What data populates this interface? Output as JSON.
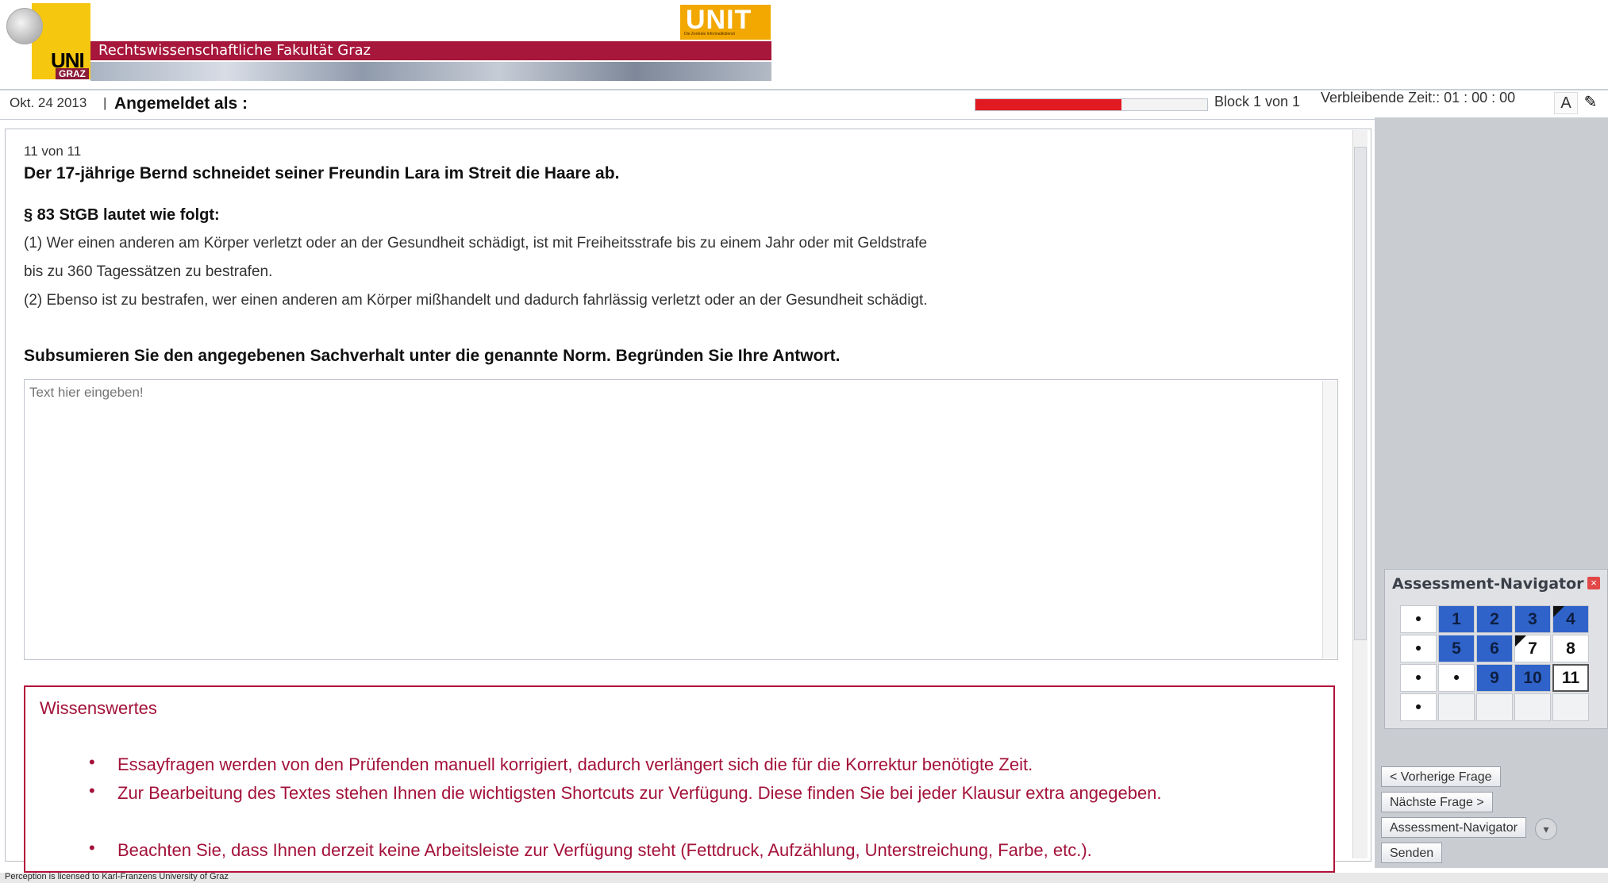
{
  "header": {
    "uni_logo": "UNI",
    "uni_sub": "GRAZ",
    "faculty": "Rechtswissenschaftliche Fakultät Graz",
    "unit_logo": "UNIT",
    "unit_sub": "Die Zentrale Informatikdienst"
  },
  "status": {
    "date": "Okt. 24 2013",
    "separator": "|",
    "login_label": "Angemeldet als :",
    "progress_fraction": 0.63,
    "progress_color": "#e11a22",
    "block": "Block 1 von 1",
    "remaining_time": "Verbleibende Zeit:: 01 : 00 : 00",
    "font_button": "A",
    "pen_button": "✎"
  },
  "question": {
    "number": "11  von 11",
    "title": "Der 17-jährige Bernd schneidet seiner Freundin Lara im Streit die Haare ab.",
    "law_title": "§ 83 StGB lautet wie folgt:",
    "law_line1": "(1) Wer einen anderen am Körper verletzt oder an der Gesundheit schädigt, ist mit Freiheitsstrafe bis zu einem Jahr oder mit Geldstrafe",
    "law_line2": "bis zu 360 Tagessätzen zu bestrafen.",
    "law_line3": "(2) Ebenso ist zu bestrafen, wer einen anderen am Körper mißhandelt und dadurch fahrlässig verletzt oder an der Gesundheit schädigt.",
    "instruction": "Subsumieren Sie den angegebenen Sachverhalt unter die genannte Norm. Begründen Sie Ihre Antwort.",
    "answer_placeholder": "Text hier eingeben!"
  },
  "info": {
    "title": "Wissenswertes",
    "bullet": "•",
    "items": [
      "Essayfragen werden von den Prüfenden manuell korrigiert, dadurch verlängert sich die für die Korrektur benötigte Zeit.",
      "Zur Bearbeitung des Textes stehen Ihnen die wichtigsten Shortcuts zur Verfügung. Diese finden Sie bei jeder Klausur extra angegeben.",
      "Beachten Sie, dass Ihnen derzeit keine Arbeitsleiste zur Verfügung steht (Fettdruck, Aufzählung, Unterstreichung, Farbe, etc.)."
    ]
  },
  "navigator": {
    "title": "Assessment-Navigator",
    "close": "×",
    "cells": [
      {
        "label": "•",
        "state": "plain"
      },
      {
        "label": "1",
        "state": "answered"
      },
      {
        "label": "2",
        "state": "answered"
      },
      {
        "label": "3",
        "state": "answered"
      },
      {
        "label": "4",
        "state": "answered-flag"
      },
      {
        "label": "•",
        "state": "plain"
      },
      {
        "label": "5",
        "state": "answered"
      },
      {
        "label": "6",
        "state": "answered"
      },
      {
        "label": "7",
        "state": "flag"
      },
      {
        "label": "8",
        "state": "plain"
      },
      {
        "label": "•",
        "state": "plain"
      },
      {
        "label": "•",
        "state": "plain"
      },
      {
        "label": "9",
        "state": "answered"
      },
      {
        "label": "10",
        "state": "answered"
      },
      {
        "label": "11",
        "state": "current"
      },
      {
        "label": "•",
        "state": "plain"
      },
      {
        "label": "",
        "state": "empty"
      },
      {
        "label": "",
        "state": "empty"
      },
      {
        "label": "",
        "state": "empty"
      },
      {
        "label": "",
        "state": "empty"
      }
    ],
    "answered_color": "#2f63c9"
  },
  "buttons": {
    "prev": "< Vorherige Frage",
    "next": "Nächste Frage >",
    "navigator": "Assessment-Navigator",
    "send": "Senden"
  },
  "footer": "Perception is licensed to Karl-Franzens University of Graz"
}
